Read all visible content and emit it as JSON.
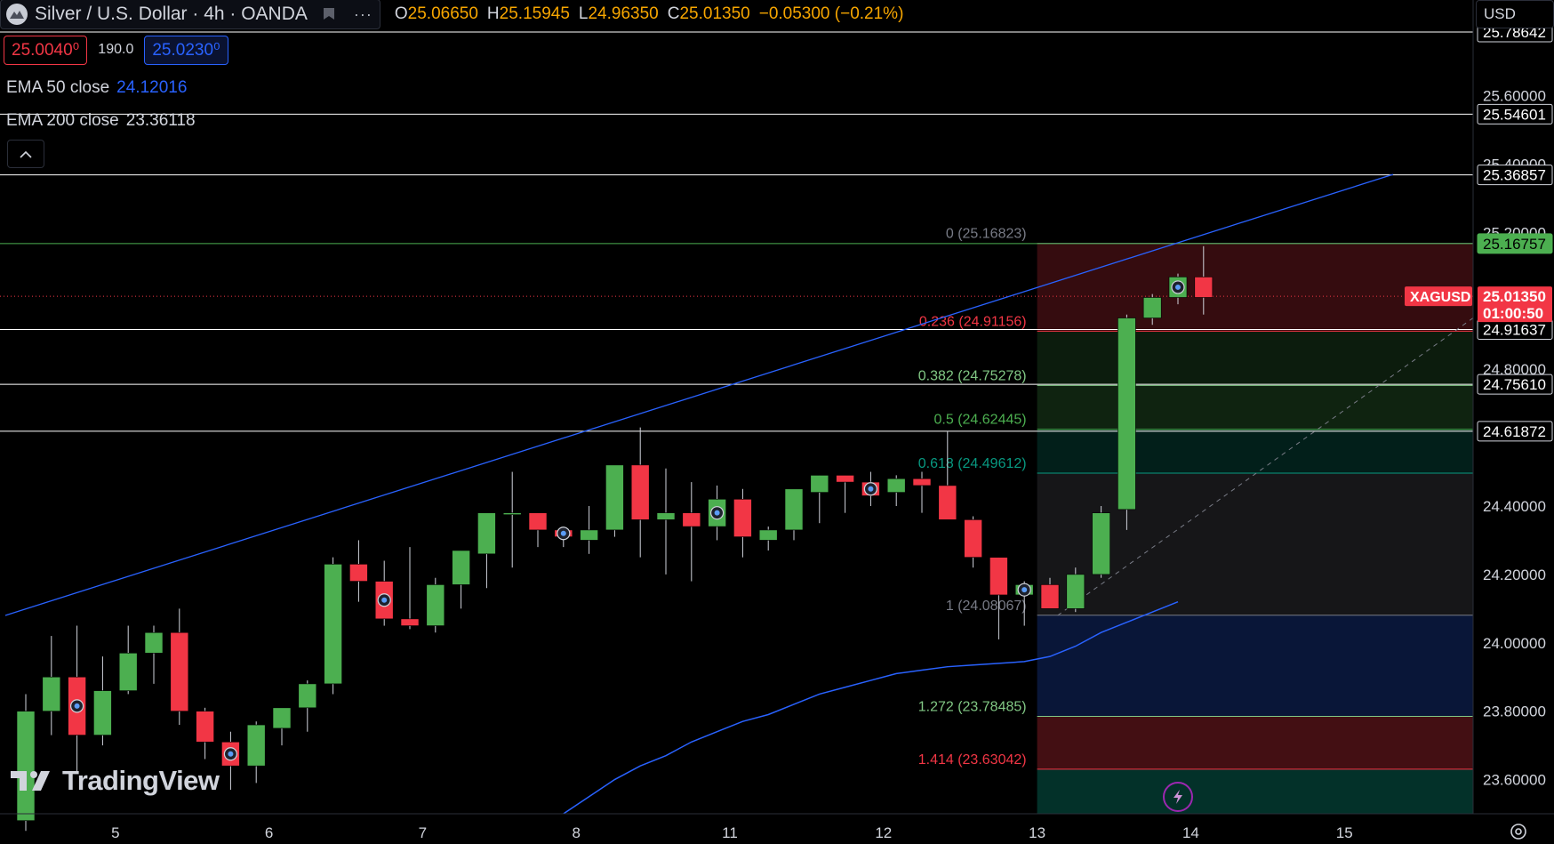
{
  "header": {
    "symbol_title": "Silver / U.S. Dollar · 4h · OANDA",
    "more_label": "···",
    "ohlc": [
      {
        "k": "O",
        "v": "25.06650"
      },
      {
        "k": "H",
        "v": "25.15945"
      },
      {
        "k": "L",
        "v": "24.96350"
      },
      {
        "k": "C",
        "v": "25.01350"
      },
      {
        "k": "",
        "v": "−0.05300 (−0.21%)"
      }
    ],
    "bid": "25.0040⁰",
    "spread": "190.0",
    "ask": "25.0230⁰",
    "currency": "USD"
  },
  "indicators": {
    "ema50_label": "EMA 50 close",
    "ema50_value": "24.12016",
    "ema200_label": "EMA 200 close",
    "ema200_value": "23.36118"
  },
  "watermark": "TradingView",
  "colors": {
    "up": "#4caf50",
    "down": "#f23645",
    "ema50": "#2962ff",
    "background": "#000000",
    "grid_text": "#d1d4dc"
  },
  "chart_data": {
    "type": "candlestick",
    "symbol": "XAGUSD",
    "last_price": "25.01350",
    "countdown": "01:00:50",
    "ylim": [
      23.5,
      25.88
    ],
    "price_axis_ticks": [
      "25.60000",
      "25.40000",
      "25.20000",
      "24.80000",
      "24.40000",
      "24.20000",
      "24.00000",
      "23.80000",
      "23.60000"
    ],
    "x_tick_labels": [
      {
        "label": "5",
        "bar": 3.5
      },
      {
        "label": "6",
        "bar": 9.5
      },
      {
        "label": "7",
        "bar": 15.5
      },
      {
        "label": "8",
        "bar": 21.5
      },
      {
        "label": "11",
        "bar": 27.5
      },
      {
        "label": "12",
        "bar": 33.5
      },
      {
        "label": "13",
        "bar": 39.5
      },
      {
        "label": "14",
        "bar": 45.5
      },
      {
        "label": "15",
        "bar": 51.5
      }
    ],
    "candles": [
      [
        23.48,
        23.85,
        23.45,
        23.8
      ],
      [
        23.8,
        24.02,
        23.73,
        23.9
      ],
      [
        23.9,
        24.05,
        23.62,
        23.73
      ],
      [
        23.73,
        23.96,
        23.7,
        23.86
      ],
      [
        23.86,
        24.05,
        23.85,
        23.97
      ],
      [
        23.97,
        24.05,
        23.88,
        24.03
      ],
      [
        24.03,
        24.1,
        23.76,
        23.8
      ],
      [
        23.8,
        23.81,
        23.66,
        23.71
      ],
      [
        23.71,
        23.74,
        23.57,
        23.64
      ],
      [
        23.64,
        23.77,
        23.59,
        23.76
      ],
      [
        23.75,
        23.81,
        23.7,
        23.81
      ],
      [
        23.81,
        23.89,
        23.74,
        23.88
      ],
      [
        23.88,
        24.25,
        23.85,
        24.23
      ],
      [
        24.23,
        24.3,
        24.12,
        24.18
      ],
      [
        24.18,
        24.24,
        24.05,
        24.07
      ],
      [
        24.07,
        24.28,
        24.04,
        24.05
      ],
      [
        24.05,
        24.19,
        24.03,
        24.17
      ],
      [
        24.17,
        24.27,
        24.1,
        24.27
      ],
      [
        24.26,
        24.36,
        24.16,
        24.38
      ],
      [
        24.38,
        24.5,
        24.22,
        24.38
      ],
      [
        24.38,
        24.38,
        24.28,
        24.33
      ],
      [
        24.33,
        24.33,
        24.28,
        24.31
      ],
      [
        24.3,
        24.4,
        24.26,
        24.33
      ],
      [
        24.33,
        24.52,
        24.31,
        24.52
      ],
      [
        24.52,
        24.63,
        24.25,
        24.36
      ],
      [
        24.36,
        24.51,
        24.2,
        24.38
      ],
      [
        24.38,
        24.47,
        24.18,
        24.34
      ],
      [
        24.34,
        24.46,
        24.3,
        24.42
      ],
      [
        24.42,
        24.45,
        24.25,
        24.31
      ],
      [
        24.3,
        24.34,
        24.27,
        24.33
      ],
      [
        24.33,
        24.45,
        24.3,
        24.45
      ],
      [
        24.44,
        24.49,
        24.35,
        24.49
      ],
      [
        24.49,
        24.49,
        24.38,
        24.47
      ],
      [
        24.47,
        24.5,
        24.4,
        24.43
      ],
      [
        24.44,
        24.49,
        24.4,
        24.48
      ],
      [
        24.48,
        24.5,
        24.38,
        24.46
      ],
      [
        24.46,
        24.62,
        24.38,
        24.36
      ],
      [
        24.36,
        24.37,
        24.22,
        24.25
      ],
      [
        24.25,
        24.25,
        24.01,
        24.14
      ],
      [
        24.14,
        24.18,
        24.05,
        24.17
      ],
      [
        24.17,
        24.19,
        24.1,
        24.1
      ],
      [
        24.1,
        24.22,
        24.09,
        24.2
      ],
      [
        24.2,
        24.4,
        24.19,
        24.38
      ],
      [
        24.39,
        24.96,
        24.33,
        24.95
      ],
      [
        24.95,
        25.02,
        24.93,
        25.01
      ],
      [
        25.01,
        25.08,
        24.99,
        25.07
      ],
      [
        25.07,
        25.16,
        24.96,
        25.01
      ]
    ],
    "markers_bars": [
      2,
      8,
      14,
      21,
      27,
      33,
      39,
      45
    ],
    "horizontal_lines": [
      {
        "price": 25.78642,
        "label": "25.78642",
        "color": "#ffffff"
      },
      {
        "price": 25.54601,
        "label": "25.54601",
        "color": "#ffffff"
      },
      {
        "price": 25.36857,
        "label": "25.36857",
        "color": "#ffffff"
      },
      {
        "price": 25.16757,
        "label": "25.16757",
        "color": "#4caf50"
      },
      {
        "price": 24.91637,
        "label": "24.91637",
        "color": "#ffffff"
      },
      {
        "price": 24.7561,
        "label": "24.75610",
        "color": "#ffffff"
      },
      {
        "price": 24.61872,
        "label": "24.61872",
        "color": "#ffffff"
      }
    ],
    "fib_levels": [
      {
        "ratio": "0",
        "price": 25.16823,
        "label": "0 (25.16823)",
        "color": "#787b86",
        "fill": "rgba(242,54,69,0.22)"
      },
      {
        "ratio": "0.236",
        "price": 24.91156,
        "label": "0.236 (24.91156)",
        "color": "#f23645",
        "fill": "rgba(76,175,80,0.16)"
      },
      {
        "ratio": "0.382",
        "price": 24.75278,
        "label": "0.382 (24.75278)",
        "color": "#81c784",
        "fill": "rgba(76,175,80,0.20)"
      },
      {
        "ratio": "0.5",
        "price": 24.62445,
        "label": "0.5 (24.62445)",
        "color": "#4caf50",
        "fill": "rgba(8,153,129,0.20)"
      },
      {
        "ratio": "0.618",
        "price": 24.49612,
        "label": "0.618 (24.49612)",
        "color": "#089981",
        "fill": "rgba(120,123,134,0.18)"
      },
      {
        "ratio": "1",
        "price": 24.08067,
        "label": "1 (24.08067)",
        "color": "#787b86",
        "fill": "rgba(41,98,255,0.22)"
      },
      {
        "ratio": "1.272",
        "price": 23.78485,
        "label": "1.272 (23.78485)",
        "color": "#81c784",
        "fill": "rgba(242,54,69,0.28)"
      },
      {
        "ratio": "1.414",
        "price": 23.63042,
        "label": "1.414 (23.63042)",
        "color": "#f23645",
        "fill": "rgba(8,153,129,0.32)"
      }
    ],
    "fib_start_bar": 39.5,
    "trendline": {
      "x1_bar": -0.8,
      "p1": 24.08,
      "x2_bar": 53.4,
      "p2": 25.37
    },
    "dashed_line": {
      "x1_bar": 40.3,
      "p1": 24.08,
      "x2_bar": 56.9,
      "p2": 24.97
    },
    "ema50": [
      [
        21.0,
        23.5
      ],
      [
        22.0,
        23.55
      ],
      [
        23.0,
        23.6
      ],
      [
        24.0,
        23.64
      ],
      [
        25.0,
        23.67
      ],
      [
        26.0,
        23.71
      ],
      [
        27.0,
        23.74
      ],
      [
        28.0,
        23.77
      ],
      [
        29.0,
        23.79
      ],
      [
        30.0,
        23.82
      ],
      [
        31.0,
        23.85
      ],
      [
        32.0,
        23.87
      ],
      [
        33.0,
        23.89
      ],
      [
        34.0,
        23.91
      ],
      [
        35.0,
        23.92
      ],
      [
        36.0,
        23.93
      ],
      [
        37.0,
        23.935
      ],
      [
        38.0,
        23.94
      ],
      [
        39.0,
        23.945
      ],
      [
        40.0,
        23.96
      ],
      [
        41.0,
        23.99
      ],
      [
        42.0,
        24.03
      ],
      [
        43.0,
        24.06
      ],
      [
        44.0,
        24.09
      ],
      [
        45.0,
        24.12
      ]
    ]
  }
}
